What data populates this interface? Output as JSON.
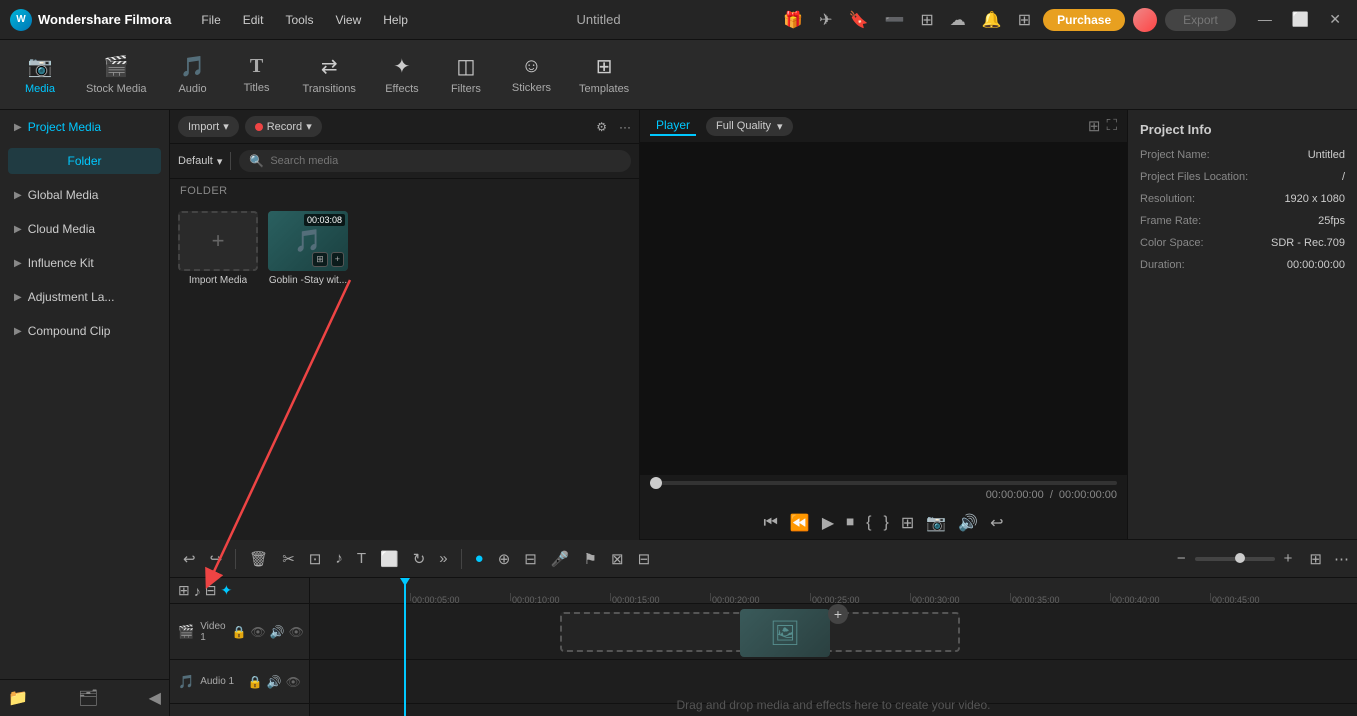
{
  "app": {
    "name": "Wondershare Filmora",
    "title": "Untitled"
  },
  "titlebar": {
    "menu": [
      "File",
      "Edit",
      "Tools",
      "View",
      "Help"
    ],
    "purchase_label": "Purchase",
    "export_label": "Export",
    "win_controls": [
      "—",
      "⬜",
      "✕"
    ]
  },
  "toolbar": {
    "items": [
      {
        "id": "media",
        "label": "Media",
        "icon": "📷",
        "active": true
      },
      {
        "id": "stock",
        "label": "Stock Media",
        "icon": "🎬"
      },
      {
        "id": "audio",
        "label": "Audio",
        "icon": "🎵"
      },
      {
        "id": "titles",
        "label": "Titles",
        "icon": "T"
      },
      {
        "id": "transitions",
        "label": "Transitions",
        "icon": "⇄"
      },
      {
        "id": "effects",
        "label": "Effects",
        "icon": "✦"
      },
      {
        "id": "filters",
        "label": "Filters",
        "icon": "◫"
      },
      {
        "id": "stickers",
        "label": "Stickers",
        "icon": "☺"
      },
      {
        "id": "templates",
        "label": "Templates",
        "icon": "⊞"
      }
    ]
  },
  "sidebar": {
    "items": [
      {
        "label": "Project Media",
        "active": true
      },
      {
        "label": "Global Media"
      },
      {
        "label": "Cloud Media"
      },
      {
        "label": "Influence Kit"
      },
      {
        "label": "Adjustment La..."
      },
      {
        "label": "Compound Clip"
      }
    ],
    "folder": "Folder"
  },
  "media_panel": {
    "import_label": "Import",
    "record_label": "Record",
    "filter_label": "Filter",
    "more_label": "More",
    "default_label": "Default",
    "search_placeholder": "Search media",
    "folder_label": "FOLDER",
    "items": [
      {
        "label": "Import Media",
        "type": "import"
      },
      {
        "label": "Goblin -Stay wit...",
        "type": "video",
        "duration": "00:03:08"
      }
    ]
  },
  "player": {
    "tab": "Player",
    "quality": "Full Quality",
    "time_current": "00:00:00:00",
    "time_total": "00:00:00:00",
    "controls": [
      "⏮",
      "⏪",
      "▶",
      "⏹",
      "{",
      "}",
      "⊞",
      "📷",
      "🔊",
      "↩"
    ]
  },
  "project_info": {
    "title": "Project Info",
    "fields": [
      {
        "key": "Project Name:",
        "value": "Untitled"
      },
      {
        "key": "Project Files Location:",
        "value": "/"
      },
      {
        "key": "Resolution:",
        "value": "1920 x 1080"
      },
      {
        "key": "Frame Rate:",
        "value": "25fps"
      },
      {
        "key": "Color Space:",
        "value": "SDR - Rec.709"
      },
      {
        "key": "Duration:",
        "value": "00:00:00:00"
      }
    ]
  },
  "timeline": {
    "drop_hint": "Drag and drop media and effects here to create your video.",
    "ruler_marks": [
      "00:00:05:00",
      "00:00:10:00",
      "00:00:15:00",
      "00:00:20:00",
      "00:00:25:00",
      "00:00:30:00",
      "00:00:35:00",
      "00:00:40:00",
      "00:00:45:00"
    ],
    "tracks": [
      {
        "label": "Video 1",
        "type": "video"
      },
      {
        "label": "Audio 1",
        "type": "audio"
      }
    ]
  }
}
